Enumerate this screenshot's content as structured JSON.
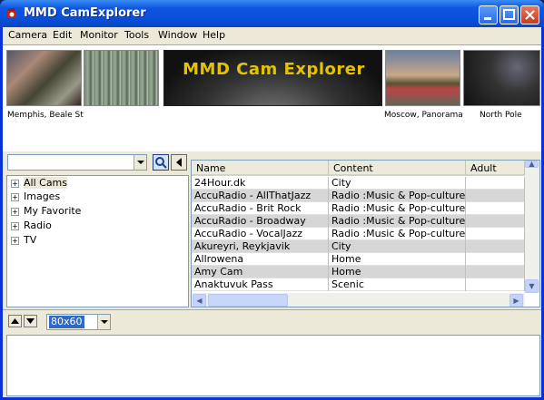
{
  "window": {
    "title": "MMD CamExplorer"
  },
  "menu": [
    "Camera",
    "Edit",
    "Monitor",
    "Tools",
    "Window",
    "Help"
  ],
  "banner": {
    "text": "MMD Cam Explorer"
  },
  "thumbnails": [
    {
      "caption": "Memphis, Beale St"
    },
    {
      "caption": ""
    },
    {
      "caption": "Moscow, Panorama"
    },
    {
      "caption": "North Pole"
    }
  ],
  "search": {
    "value": ""
  },
  "tree": [
    "All Cams",
    "Images",
    "My Favorite",
    "Radio",
    "TV"
  ],
  "columns": [
    "Name",
    "Content",
    "Adult"
  ],
  "rows": [
    {
      "name": "24Hour.dk",
      "content": "City",
      "adult": ""
    },
    {
      "name": "AccuRadio - AllThatJazz",
      "content": "Radio :Music & Pop-culture:Ja",
      "adult": ""
    },
    {
      "name": "AccuRadio - Brit Rock",
      "content": "Radio :Music & Pop-culture:R",
      "adult": ""
    },
    {
      "name": "AccuRadio - Broadway",
      "content": "Radio :Music & Pop-culture:P",
      "adult": ""
    },
    {
      "name": "AccuRadio - VocalJazz",
      "content": "Radio :Music & Pop-culture:Ja",
      "adult": ""
    },
    {
      "name": "Akureyri, Reykjavik",
      "content": "City",
      "adult": ""
    },
    {
      "name": "Allrowena",
      "content": "Home",
      "adult": ""
    },
    {
      "name": "Amy Cam",
      "content": "Home",
      "adult": ""
    },
    {
      "name": "Anaktuvuk Pass",
      "content": "Scenic",
      "adult": ""
    }
  ],
  "size_select": {
    "value": "80x60"
  },
  "icons": {
    "app": "camera-icon",
    "search": "magnifier-icon",
    "back": "triangle-left-icon",
    "up": "triangle-up-icon",
    "down": "triangle-down-icon"
  },
  "colors": {
    "titlebar": "#0a4fd8",
    "selected": "#316ac5",
    "banner_text": "#e6c300"
  }
}
